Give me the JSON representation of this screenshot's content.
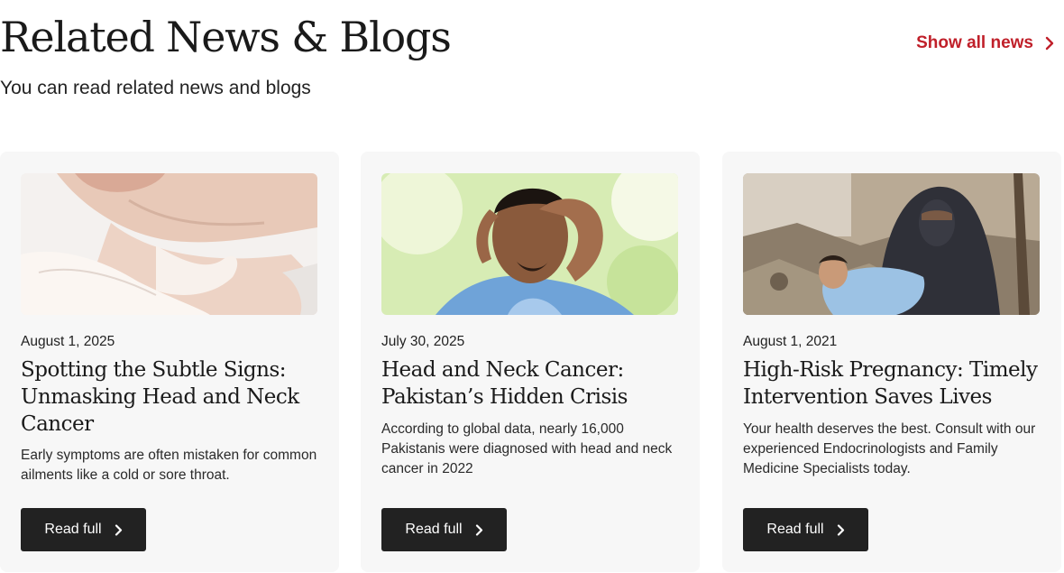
{
  "header": {
    "title": "Related News & Blogs",
    "subtitle": "You can read related news and blogs",
    "show_all_label": "Show all news",
    "accent_color": "#c0202a"
  },
  "cards": [
    {
      "image_icon": "throat-exam-photo",
      "date": "August 1, 2025",
      "title": "Spotting the Subtle Signs: Unmasking Head and Neck Cancer",
      "description": "Early symptoms are often mistaken for common ailments like a cold or sore throat.",
      "button_label": "Read full"
    },
    {
      "image_icon": "stressed-man-photo",
      "date": "July 30, 2025",
      "title": "Head and Neck Cancer: Pakistan’s Hidden Crisis",
      "description": "According to global data, nearly 16,000 Pakistanis were diagnosed with head and neck cancer in 2022",
      "button_label": "Read full"
    },
    {
      "image_icon": "mother-and-baby-photo",
      "date": "August 1, 2021",
      "title": "High-Risk Pregnancy: Timely Intervention Saves Lives",
      "description": "Your health deserves the best. Consult with our experienced Endocrinologists and Family Medicine Specialists today.",
      "button_label": "Read full"
    }
  ]
}
